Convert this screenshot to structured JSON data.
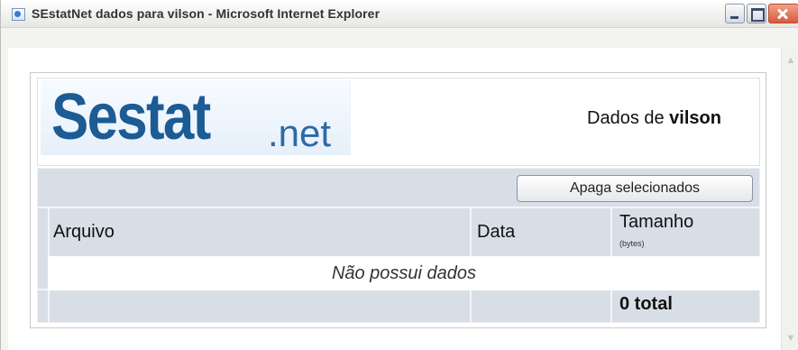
{
  "window": {
    "title": "SEstatNet dados para vilson - Microsoft Internet Explorer"
  },
  "header": {
    "logo_main": "Sestat",
    "logo_suffix": ".net",
    "dados_prefix": "Dados de ",
    "username": "vilson"
  },
  "toolbar": {
    "delete_label": "Apaga selecionados"
  },
  "table": {
    "columns": [
      {
        "label": "Arquivo"
      },
      {
        "label": "Data"
      },
      {
        "label": "Tamanho",
        "unit": "(bytes)"
      }
    ],
    "empty_message": "Não possui dados",
    "total": "0 total"
  },
  "colors": {
    "brand": "#1c5b94",
    "table_bg": "#d8dee6"
  },
  "icons": {
    "window": "ie-page-icon",
    "minimize": "minimize-icon",
    "maximize": "maximize-icon",
    "close": "close-icon"
  }
}
